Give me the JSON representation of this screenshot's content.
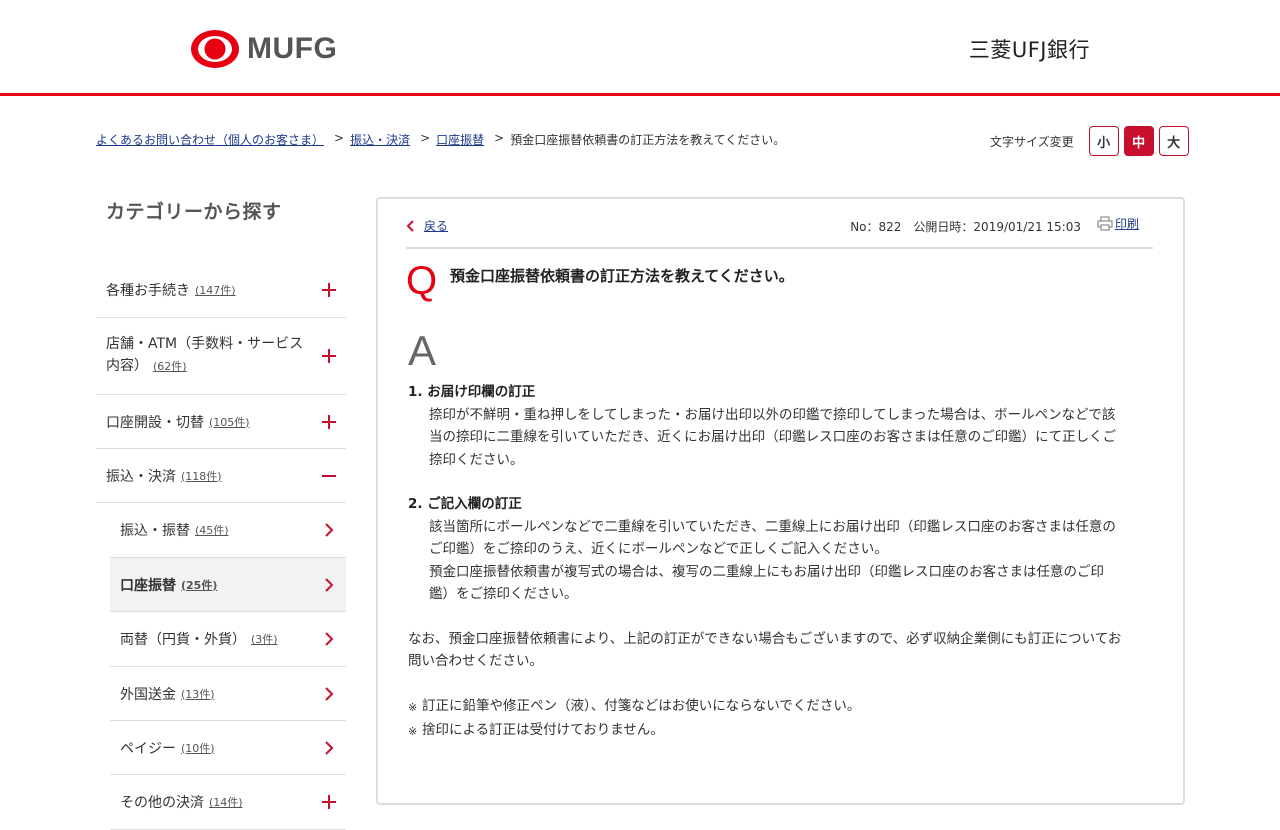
{
  "header": {
    "logo_text": "MUFG",
    "bank_name": "三菱UFJ銀行",
    "accent_color": "#e60012"
  },
  "breadcrumb": [
    "よくあるお問い合わせ（個人のお客さま）",
    "振込・決済",
    "口座振替",
    "預金口座振替依頼書の訂正方法を教えてください。"
  ],
  "breadcrumb_sep": ">",
  "font_size": {
    "label": "文字サイズ変更",
    "small": "小",
    "medium": "中",
    "large": "大",
    "selected": "中"
  },
  "sidebar": {
    "title": "カテゴリーから探す",
    "items": [
      {
        "label": "各種お手続き",
        "count": "(147件)",
        "icon": "plus-icon"
      },
      {
        "label": "店舗・ATM（手数料・サービス",
        "label2": "内容）",
        "count": "(62件)",
        "icon": "plus-icon"
      },
      {
        "label": "口座開設・切替",
        "count": "(105件)",
        "icon": "plus-icon"
      },
      {
        "label": "振込・決済",
        "count": "(118件)",
        "icon": "minus-icon"
      },
      {
        "label": "振込・振替",
        "count": "(45件)",
        "icon": "chevron-right-icon"
      },
      {
        "label": "口座振替",
        "count": "(25件)",
        "icon": "chevron-right-icon"
      },
      {
        "label": "両替（円貨・外貨）",
        "count": "(3件)",
        "icon": "chevron-right-icon"
      },
      {
        "label": "外国送金",
        "count": "(13件)",
        "icon": "chevron-right-icon"
      },
      {
        "label": "ペイジー",
        "count": "(10件)",
        "icon": "chevron-right-icon"
      },
      {
        "label": "その他の決済",
        "count": "(14件)",
        "icon": "plus-icon"
      }
    ]
  },
  "content": {
    "back_label": "戻る",
    "meta": "No：822　公開日時：2019/01/21 15:03",
    "print_label": "印刷",
    "q_mark": "Q",
    "question": "預金口座振替依頼書の訂正方法を教えてください。",
    "a_mark": "A",
    "section1_head": "1. お届け印欄の訂正",
    "section1_lines": [
      "捺印が不鮮明・重ね押しをしてしまった・お届け出印以外の印鑑で捺印してしまった場合は、ボールペンなどで該",
      "当の捺印に二重線を引いていただき、近くにお届け出印（印鑑レス口座のお客さまは任意のご印鑑）にて正しくご",
      "捺印ください。"
    ],
    "section2_head": "2. ご記入欄の訂正",
    "section2_lines": [
      "該当箇所にボールペンなどで二重線を引いていただき、二重線上にお届け出印（印鑑レス口座のお客さまは任意の",
      "ご印鑑）をご捺印のうえ、近くにボールペンなどで正しくご記入ください。",
      "預金口座振替依頼書が複写式の場合は、複写の二重線上にもお届け出印（印鑑レス口座のお客さまは任意のご印",
      "鑑）をご捺印ください。"
    ],
    "closing_lines": [
      "なお、預金口座振替依頼書により、上記の訂正ができない場合もございますので、必ず収納企業側にも訂正についてお",
      "問い合わせください。"
    ],
    "note_mark": "※",
    "notes": [
      "訂正に鉛筆や修正ペン（液）、付箋などはお使いにならないでください。",
      "捨印による訂正は受付けておりません。"
    ]
  }
}
